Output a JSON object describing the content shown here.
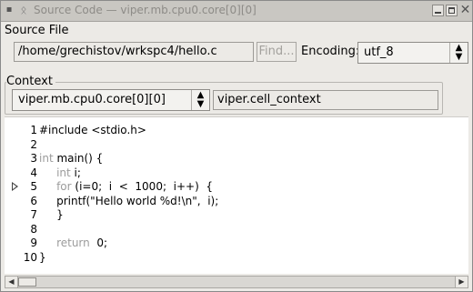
{
  "window": {
    "title": "Source Code — viper.mb.cpu0.core[0][0]",
    "menu_icon": "window-menu-icon",
    "app_icon": "app-icon",
    "controls": {
      "minimize": "minimize-icon",
      "maximize": "maximize-icon",
      "close_glyph": "✕"
    }
  },
  "source_file": {
    "label": "Source File",
    "path": "/home/grechistov/wrkspc4/hello.c",
    "find_label": "Find...",
    "encoding_label": "Encoding:",
    "encoding_value": "utf_8"
  },
  "context": {
    "label": "Context",
    "selected": "viper.mb.cpu0.core[0][0]",
    "value": "viper.cell_context"
  },
  "code": {
    "current_line": 5,
    "lines": [
      {
        "n": "1",
        "parts": [
          {
            "t": "#include <stdio.h>",
            "c": ""
          }
        ]
      },
      {
        "n": "2",
        "parts": []
      },
      {
        "n": "3",
        "parts": [
          {
            "t": "int",
            "c": "kw"
          },
          {
            "t": " main() {",
            "c": ""
          }
        ]
      },
      {
        "n": "4",
        "parts": [
          {
            "t": "     int",
            "c": "kw"
          },
          {
            "t": " i;",
            "c": ""
          }
        ]
      },
      {
        "n": "5",
        "parts": [
          {
            "t": "     for",
            "c": "kw"
          },
          {
            "t": " (i=0;  i  <  1000;  i++)  {",
            "c": ""
          }
        ]
      },
      {
        "n": "6",
        "parts": [
          {
            "t": "     printf(\"Hello world %d!\\n\",  i);",
            "c": ""
          }
        ]
      },
      {
        "n": "7",
        "parts": [
          {
            "t": "     }",
            "c": ""
          }
        ]
      },
      {
        "n": "8",
        "parts": []
      },
      {
        "n": "9",
        "parts": [
          {
            "t": "     return",
            "c": "kw"
          },
          {
            "t": "  0;",
            "c": ""
          }
        ]
      },
      {
        "n": "10",
        "parts": [
          {
            "t": "}",
            "c": ""
          }
        ]
      }
    ]
  },
  "colors": {
    "keyword": "#9c9c9c",
    "window_bg": "#eceae6",
    "titlebar_bg": "#c9c7c2"
  }
}
